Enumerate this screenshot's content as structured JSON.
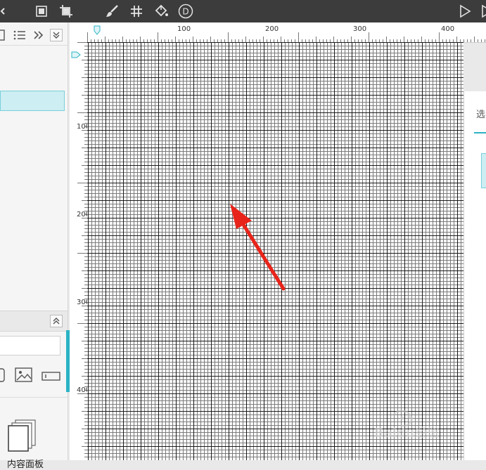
{
  "ruler": {
    "top_labels": [
      "100",
      "200",
      "300",
      "400"
    ],
    "left_labels": [
      "100",
      "200",
      "300",
      "400"
    ]
  },
  "library": {
    "item_label": "内容面板"
  },
  "right_panel": {
    "label": "选"
  },
  "watermark": {
    "text": "Baidu经验"
  },
  "toolbar": {
    "icons": [
      "frame-icon",
      "crop-icon",
      "brush-icon",
      "grid-icon",
      "paint-bucket-icon",
      "d-circle-icon",
      "play-icon",
      "play-outline-icon"
    ]
  },
  "colors": {
    "toolbar_bg": "#3c3c3c",
    "accent": "#2bb3c4",
    "selection_fill": "#cdeef2",
    "arrow": "#e8241a"
  }
}
